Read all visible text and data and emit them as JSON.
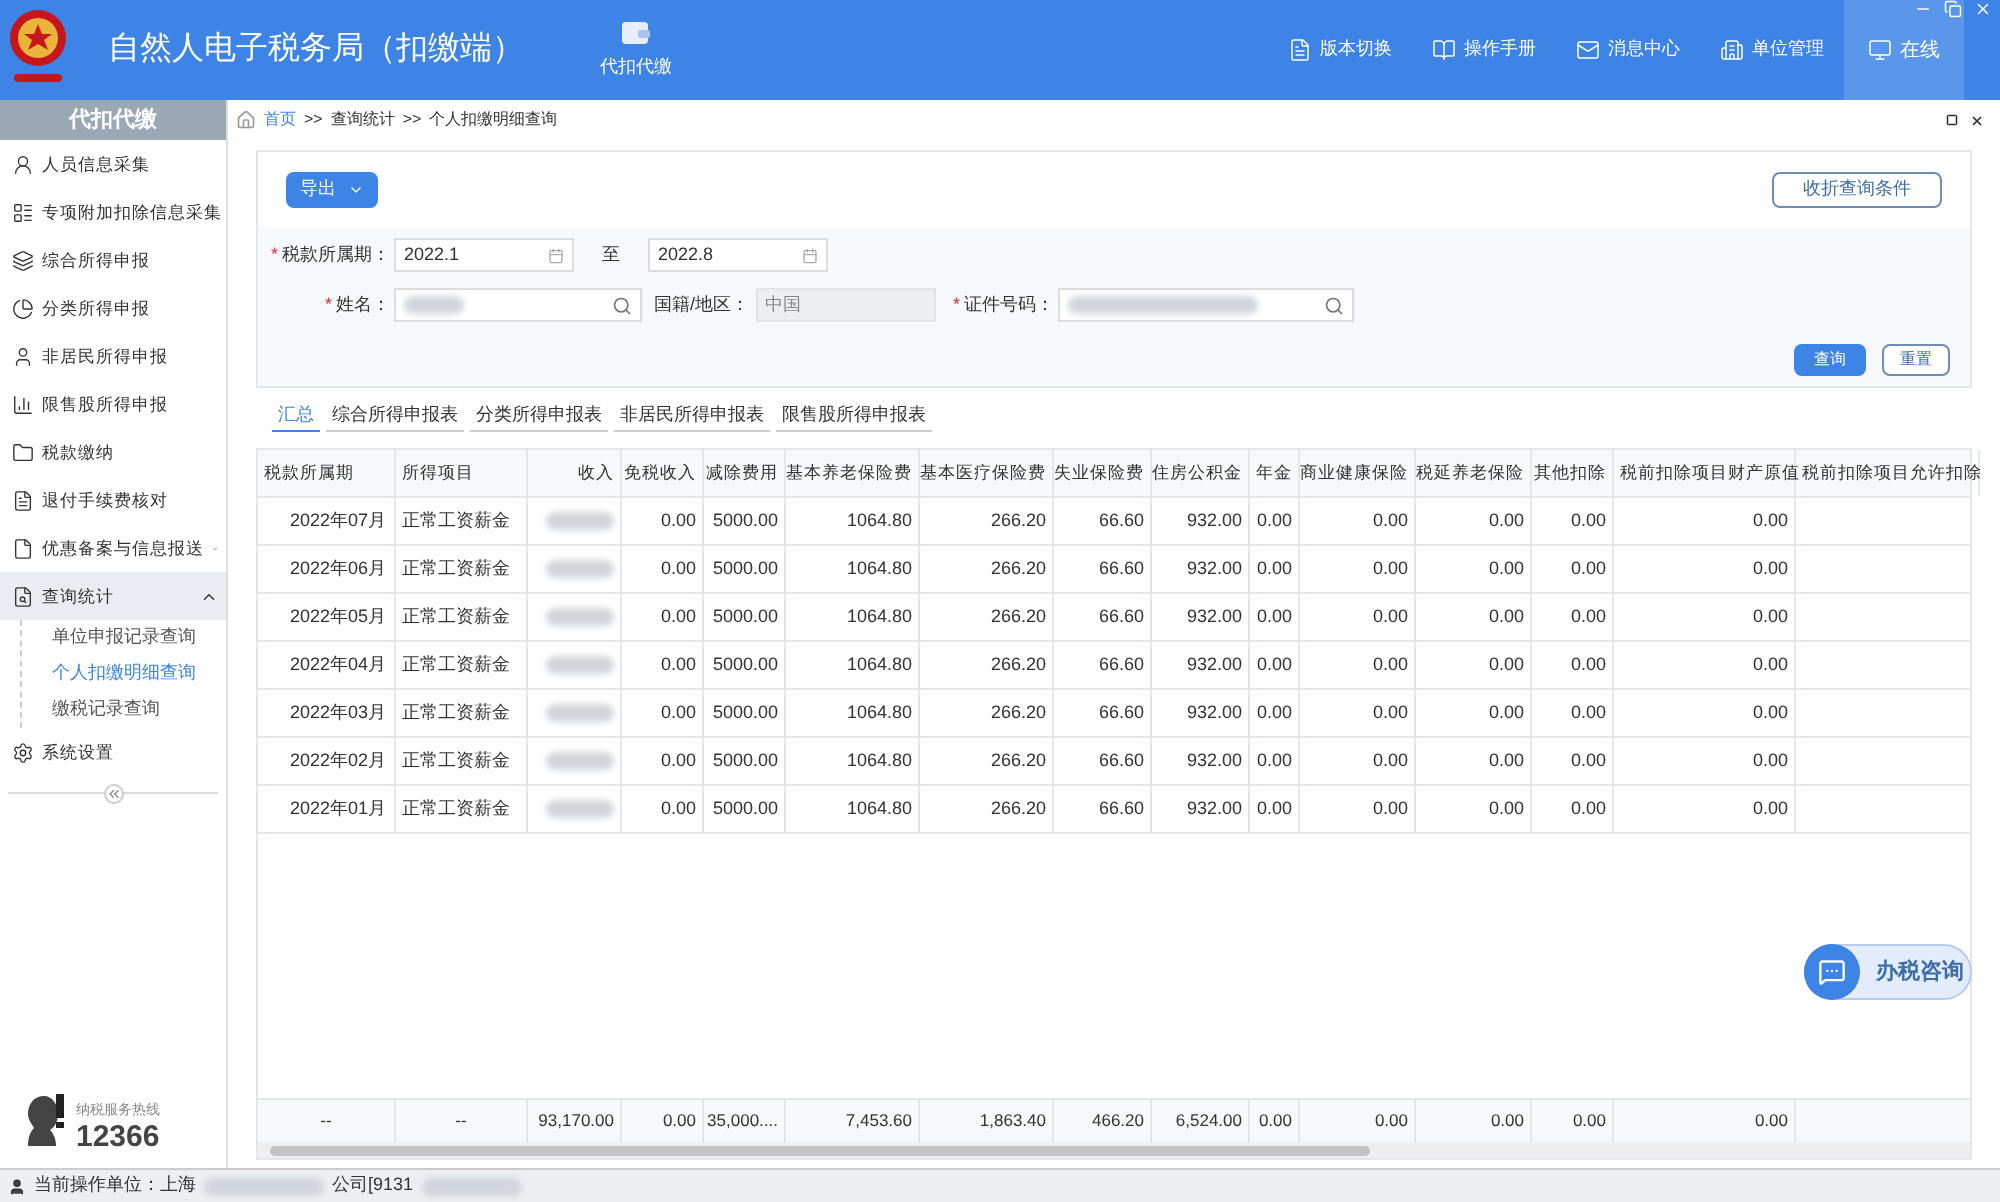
{
  "header": {
    "title": "自然人电子税务局（扣缴端）",
    "module": "代扣代缴",
    "nav": [
      {
        "label": "版本切换",
        "selected": false
      },
      {
        "label": "操作手册",
        "selected": false
      },
      {
        "label": "消息中心",
        "selected": false
      },
      {
        "label": "单位管理",
        "selected": false
      },
      {
        "label": "在线",
        "selected": true
      }
    ]
  },
  "sidebar": {
    "title": "代扣代缴",
    "items": [
      {
        "label": "人员信息采集"
      },
      {
        "label": "专项附加扣除信息采集"
      },
      {
        "label": "综合所得申报"
      },
      {
        "label": "分类所得申报"
      },
      {
        "label": "非居民所得申报"
      },
      {
        "label": "限售股所得申报"
      },
      {
        "label": "税款缴纳"
      },
      {
        "label": "退付手续费核对"
      },
      {
        "label": "优惠备案与信息报送",
        "expanded": false
      },
      {
        "label": "查询统计",
        "expanded": true,
        "children": [
          {
            "label": "单位申报记录查询",
            "selected": false
          },
          {
            "label": "个人扣缴明细查询",
            "selected": true
          },
          {
            "label": "缴税记录查询",
            "selected": false
          }
        ]
      },
      {
        "label": "系统设置"
      }
    ],
    "hotline_label": "纳税服务热线",
    "hotline_number": "12366"
  },
  "breadcrumb": [
    "首页",
    ">>",
    "查询统计",
    ">>",
    "个人扣缴明细查询"
  ],
  "toolbar": {
    "export": "导出",
    "collapse": "收折查询条件"
  },
  "form": {
    "required_mark": "*",
    "period_required": true,
    "name_required": true,
    "id_required": true,
    "period_label": "税款所属期：",
    "period_from": "2022.1",
    "to_label": "至",
    "period_to": "2022.8",
    "name_label": "姓名：",
    "country_label": "国籍/地区：",
    "country_value": "中国",
    "id_label": "证件号码：",
    "query": "查询",
    "reset": "重置"
  },
  "tabs": [
    {
      "label": "汇总",
      "selected": true
    },
    {
      "label": "综合所得申报表",
      "selected": false
    },
    {
      "label": "分类所得申报表",
      "selected": false
    },
    {
      "label": "非居民所得申报表",
      "selected": false
    },
    {
      "label": "限售股所得申报表",
      "selected": false
    }
  ],
  "table": {
    "columns": [
      "税款所属期",
      "所得项目",
      "收入",
      "免税收入",
      "减除费用",
      "基本养老保险费",
      "基本医疗保险费",
      "失业保险费",
      "住房公积金",
      "年金",
      "商业健康保险",
      "税延养老保险",
      "其他扣除",
      "税前扣除项目财产原值",
      "税前扣除项目允许扣除"
    ],
    "rows": [
      {
        "period": "2022年07月",
        "item": "正常工资薪金",
        "values": [
          "0.00",
          "5000.00",
          "1064.80",
          "266.20",
          "66.60",
          "932.00",
          "0.00",
          "0.00",
          "0.00",
          "0.00",
          "0.00"
        ]
      },
      {
        "period": "2022年06月",
        "item": "正常工资薪金",
        "values": [
          "0.00",
          "5000.00",
          "1064.80",
          "266.20",
          "66.60",
          "932.00",
          "0.00",
          "0.00",
          "0.00",
          "0.00",
          "0.00"
        ]
      },
      {
        "period": "2022年05月",
        "item": "正常工资薪金",
        "values": [
          "0.00",
          "5000.00",
          "1064.80",
          "266.20",
          "66.60",
          "932.00",
          "0.00",
          "0.00",
          "0.00",
          "0.00",
          "0.00"
        ]
      },
      {
        "period": "2022年04月",
        "item": "正常工资薪金",
        "values": [
          "0.00",
          "5000.00",
          "1064.80",
          "266.20",
          "66.60",
          "932.00",
          "0.00",
          "0.00",
          "0.00",
          "0.00",
          "0.00"
        ]
      },
      {
        "period": "2022年03月",
        "item": "正常工资薪金",
        "values": [
          "0.00",
          "5000.00",
          "1064.80",
          "266.20",
          "66.60",
          "932.00",
          "0.00",
          "0.00",
          "0.00",
          "0.00",
          "0.00"
        ]
      },
      {
        "period": "2022年02月",
        "item": "正常工资薪金",
        "values": [
          "0.00",
          "5000.00",
          "1064.80",
          "266.20",
          "66.60",
          "932.00",
          "0.00",
          "0.00",
          "0.00",
          "0.00",
          "0.00"
        ]
      },
      {
        "period": "2022年01月",
        "item": "正常工资薪金",
        "values": [
          "0.00",
          "5000.00",
          "1064.80",
          "266.20",
          "66.60",
          "932.00",
          "0.00",
          "0.00",
          "0.00",
          "0.00",
          "0.00"
        ]
      }
    ],
    "totals": [
      "--",
      "--",
      "93,170.00",
      "0.00",
      "35,000....",
      "7,453.60",
      "1,863.40",
      "466.20",
      "6,524.00",
      "0.00",
      "0.00",
      "0.00",
      "0.00",
      "0.00"
    ]
  },
  "consult": "办税咨询",
  "status_bar": {
    "label": "当前操作单位：上海",
    "company_suffix": "公司[9131"
  }
}
